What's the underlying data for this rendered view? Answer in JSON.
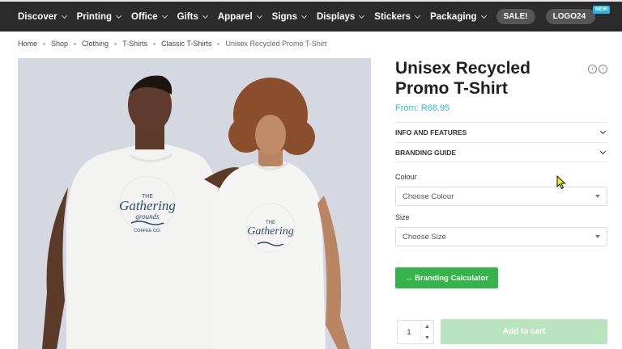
{
  "nav": {
    "items": [
      {
        "label": "Discover"
      },
      {
        "label": "Printing"
      },
      {
        "label": "Office"
      },
      {
        "label": "Gifts"
      },
      {
        "label": "Apparel"
      },
      {
        "label": "Signs"
      },
      {
        "label": "Displays"
      },
      {
        "label": "Stickers"
      },
      {
        "label": "Packaging"
      }
    ],
    "sale_label": "SALE!",
    "logo_label": "LOGO24",
    "new_badge": "NEW"
  },
  "breadcrumb": {
    "items": [
      "Home",
      "Shop",
      "Clothing",
      "T-Shirts",
      "Classic T-Shirts"
    ],
    "current": "Unisex Recycled Promo T-Shirt"
  },
  "product": {
    "title_line1": "Unisex Recycled",
    "title_line2": "Promo T-Shirt",
    "price": "From: R68.95",
    "accordions": [
      "INFO AND FEATURES",
      "BRANDING GUIDE"
    ],
    "colour_label": "Colour",
    "colour_placeholder": "Choose Colour",
    "size_label": "Size",
    "size_placeholder": "Choose Size",
    "calculator_label": "→ Branding Calculator",
    "quantity": "1",
    "add_to_cart_label": "Add to cart"
  },
  "photo": {
    "shirt_print_line1": "THE",
    "shirt_print_script": "Gathering",
    "shirt_print_sub": "grounds",
    "shirt_print_bottom": "COFFEE CO."
  },
  "colors": {
    "nav_bg": "#2b2b2b",
    "accent_price": "#2ab8e6",
    "calc_button": "#35b44a",
    "add_to_cart_disabled": "#b9e4bf",
    "photo_bg": "#d6d8e1"
  }
}
